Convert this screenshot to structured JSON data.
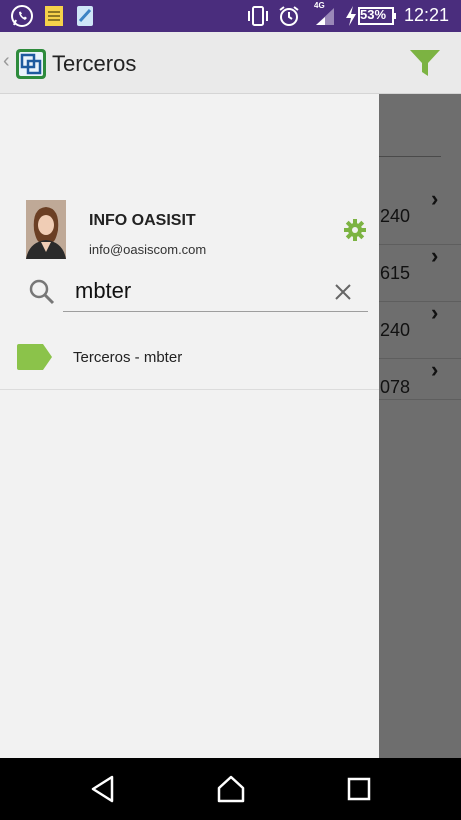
{
  "status_bar": {
    "time": "12:21",
    "battery": "53%",
    "network": "4G",
    "icons": [
      "whatsapp-icon",
      "notes-icon",
      "gallery-icon",
      "vibrate-icon",
      "alarm-icon",
      "signal-icon",
      "charging-icon",
      "battery-icon"
    ]
  },
  "app_bar": {
    "title": "Terceros",
    "back_glyph": "‹",
    "accent_color": "#7cb342"
  },
  "drawer": {
    "user": {
      "name": "INFO OASISIT",
      "email": "info@oasiscom.com"
    },
    "search": {
      "value": "mbter"
    },
    "results": [
      {
        "label": "Terceros - mbter",
        "icon": "tag-icon"
      }
    ]
  },
  "background_list": {
    "rows": [
      {
        "value": "240"
      },
      {
        "value": "615"
      },
      {
        "value": "240"
      },
      {
        "value": "078"
      }
    ]
  },
  "nav_bar": {
    "buttons": [
      "back-button",
      "home-button",
      "recents-button"
    ]
  }
}
